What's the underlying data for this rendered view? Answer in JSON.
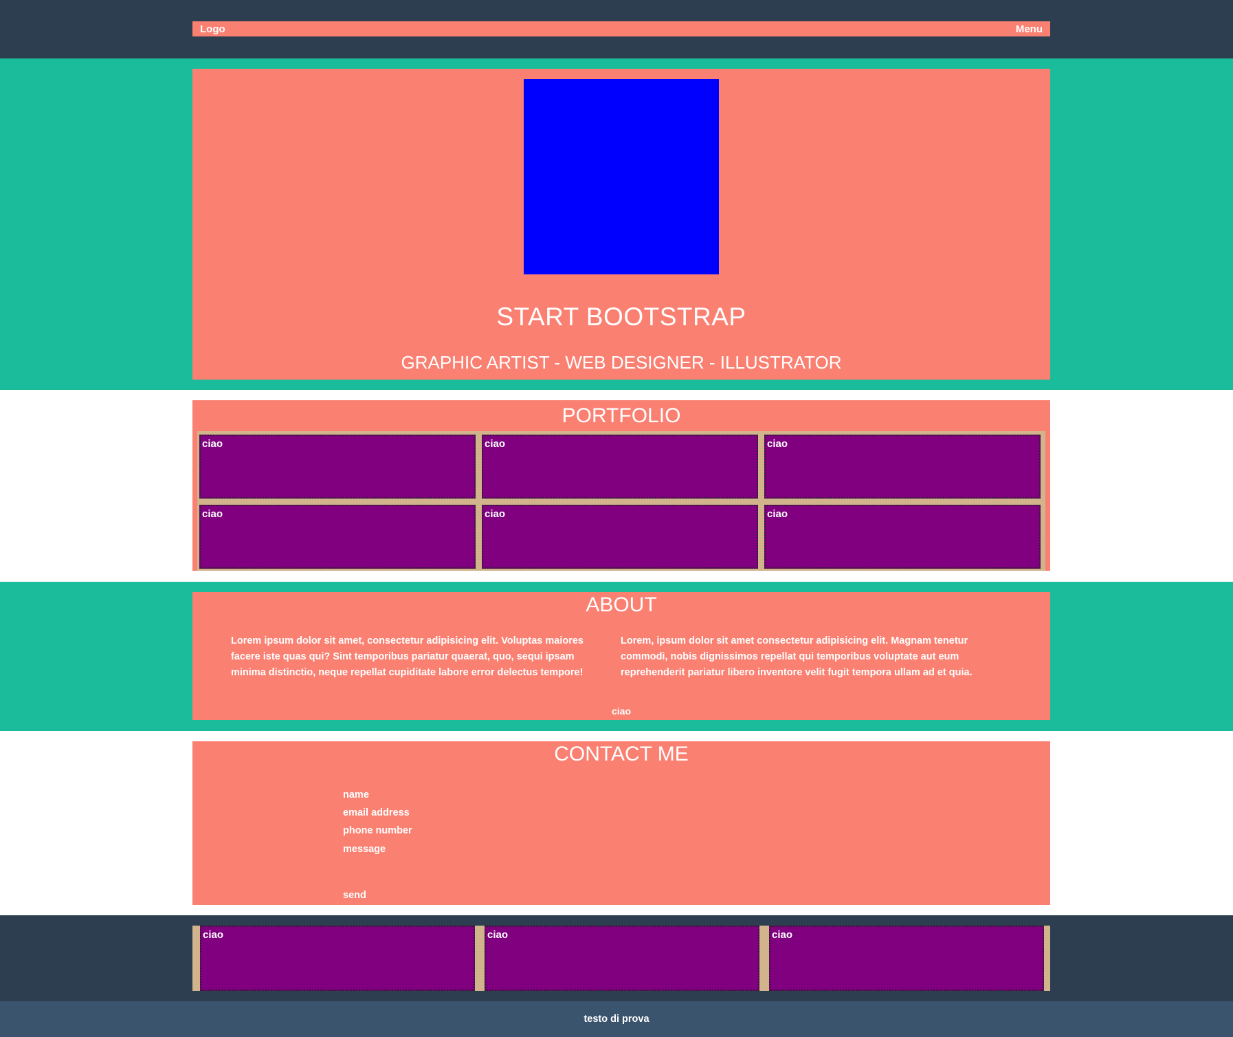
{
  "nav": {
    "logo": "Logo",
    "menu": "Menu"
  },
  "hero": {
    "title": "START BOOTSTRAP",
    "subtitle": "GRAPHIC ARTIST - WEB DESIGNER - ILLUSTRATOR"
  },
  "portfolio": {
    "title": "PORTFOLIO",
    "items": [
      "ciao",
      "ciao",
      "ciao",
      "ciao",
      "ciao",
      "ciao"
    ]
  },
  "about": {
    "title": "ABOUT",
    "left": "Lorem ipsum dolor sit amet, consectetur adipisicing elit. Voluptas maiores facere iste quas qui? Sint temporibus pariatur quaerat, quo, sequi ipsam minima distinctio, neque repellat cupiditate labore error delectus tempore!",
    "right": "Lorem, ipsum dolor sit amet consectetur adipisicing elit. Magnam tenetur commodi, nobis dignissimos repellat qui temporibus voluptate aut eum reprehenderit pariatur libero inventore velit fugit tempora ullam ad et quia.",
    "footer": "ciao"
  },
  "contact": {
    "title": "CONTACT ME",
    "name": "name",
    "email": "email address",
    "phone": "phone number",
    "message": "message",
    "send": "send"
  },
  "footer_tiles": [
    "ciao",
    "ciao",
    "ciao"
  ],
  "copyright": "testo di prova",
  "colors": {
    "navy": "#2c3e50",
    "teal": "#1abc9c",
    "salmon": "#fa8072",
    "blue": "#0000ff",
    "purple": "#800080",
    "tan": "#d2b48c"
  }
}
